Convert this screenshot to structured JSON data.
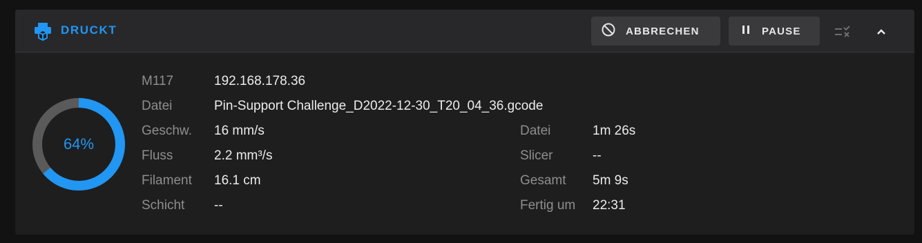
{
  "header": {
    "title": "DRUCKT",
    "cancel_label": "ABBRECHEN",
    "pause_label": "PAUSE",
    "icons": [
      "printer-icon",
      "cancel-icon",
      "pause-icon",
      "checklist-icon",
      "chevron-up-icon"
    ]
  },
  "progress": {
    "percent_text": "64%",
    "fraction": 0.64
  },
  "left_info": [
    {
      "label": "M117",
      "value": "192.168.178.36"
    },
    {
      "label": "Datei",
      "value": "Pin-Support Challenge_D2022-12-30_T20_04_36.gcode"
    },
    {
      "label": "Geschw.",
      "value": "16 mm/s"
    },
    {
      "label": "Fluss",
      "value": "2.2 mm³/s"
    },
    {
      "label": "Filament",
      "value": "16.1 cm"
    },
    {
      "label": "Schicht",
      "value": "--"
    }
  ],
  "right_info": [
    {
      "label": "Datei",
      "value": "1m 26s"
    },
    {
      "label": "Slicer",
      "value": "--"
    },
    {
      "label": "Gesamt",
      "value": "5m 9s"
    },
    {
      "label": "Fertig um",
      "value": "22:31"
    }
  ],
  "colors": {
    "accent": "#2196f3",
    "track": "#5a5a5a"
  }
}
